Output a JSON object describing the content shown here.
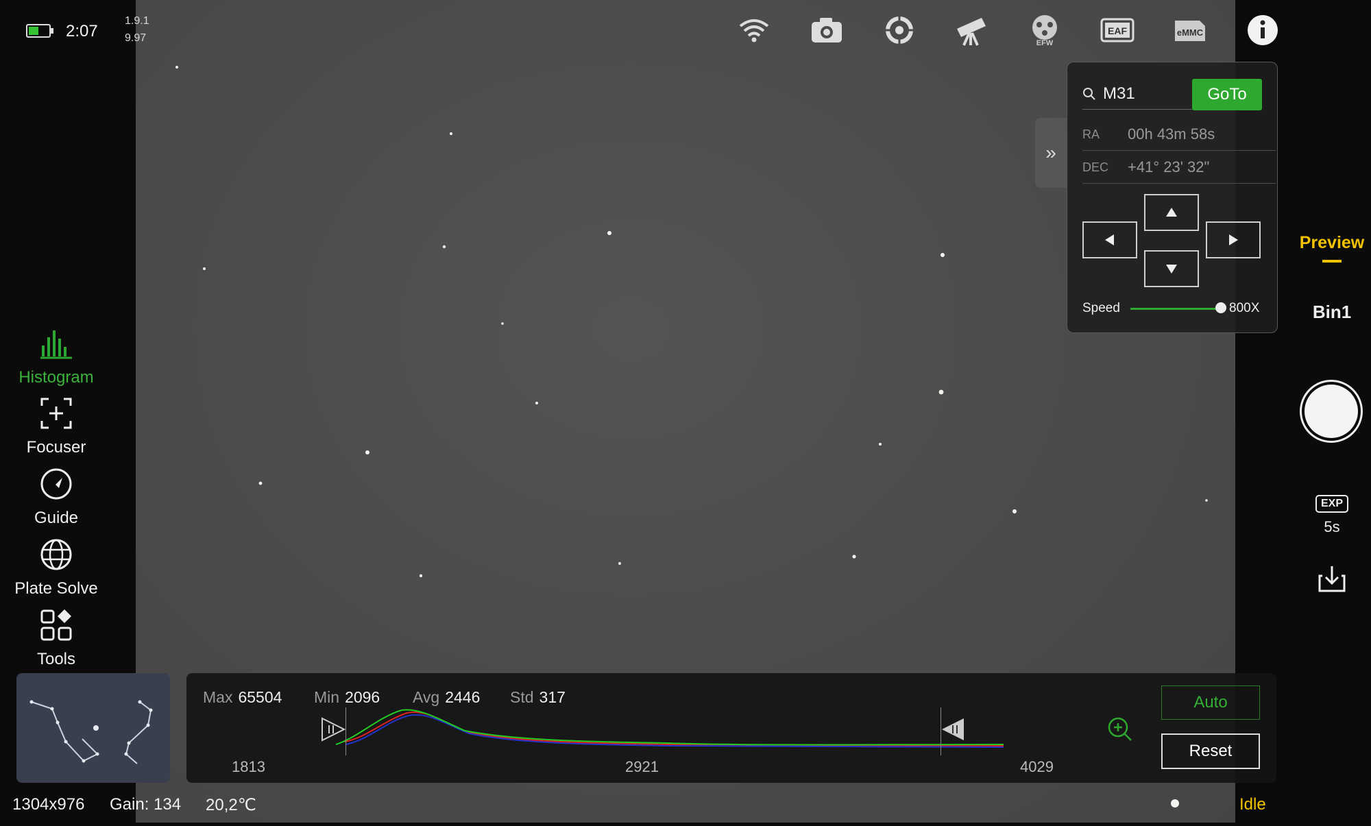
{
  "status": {
    "battery_icon": "battery-icon",
    "time": "2:07",
    "version_a": "1.9.1",
    "version_b": "9.97"
  },
  "top_icons": [
    "wifi-icon",
    "camera-icon",
    "guide-target-icon",
    "telescope-icon",
    "efw-icon",
    "eaf-icon",
    "emmc-icon",
    "info-icon"
  ],
  "top_icon_labels": {
    "efw": "EFW",
    "eaf": "EAF",
    "emmc": "eMMC"
  },
  "nav": {
    "histogram": "Histogram",
    "focuser": "Focuser",
    "guide": "Guide",
    "plate_solve": "Plate Solve",
    "tools": "Tools"
  },
  "mount": {
    "search_value": "M31",
    "goto_label": "GoTo",
    "ra_label": "RA",
    "ra_value": "00h 43m 58s",
    "dec_label": "DEC",
    "dec_value": "+41° 23' 32\"",
    "speed_label": "Speed",
    "speed_value": "800X"
  },
  "histogram": {
    "max_label": "Max",
    "max_value": "65504",
    "min_label": "Min",
    "min_value": "2096",
    "avg_label": "Avg",
    "avg_value": "2446",
    "std_label": "Std",
    "std_value": "317",
    "axis_left": "1813",
    "axis_mid": "2921",
    "axis_right": "4029",
    "auto_label": "Auto",
    "reset_label": "Reset"
  },
  "right": {
    "preview_label": "Preview",
    "bin_label": "Bin1",
    "exp_badge": "EXP",
    "exp_value": "5s"
  },
  "bottom": {
    "resolution": "1304x976",
    "gain": "Gain: 134",
    "temp": "20,2℃",
    "state": "Idle"
  },
  "colors": {
    "accent_green": "#2ea82e",
    "preview_yellow": "#f2c200",
    "idle_yellow": "#f2c200"
  }
}
